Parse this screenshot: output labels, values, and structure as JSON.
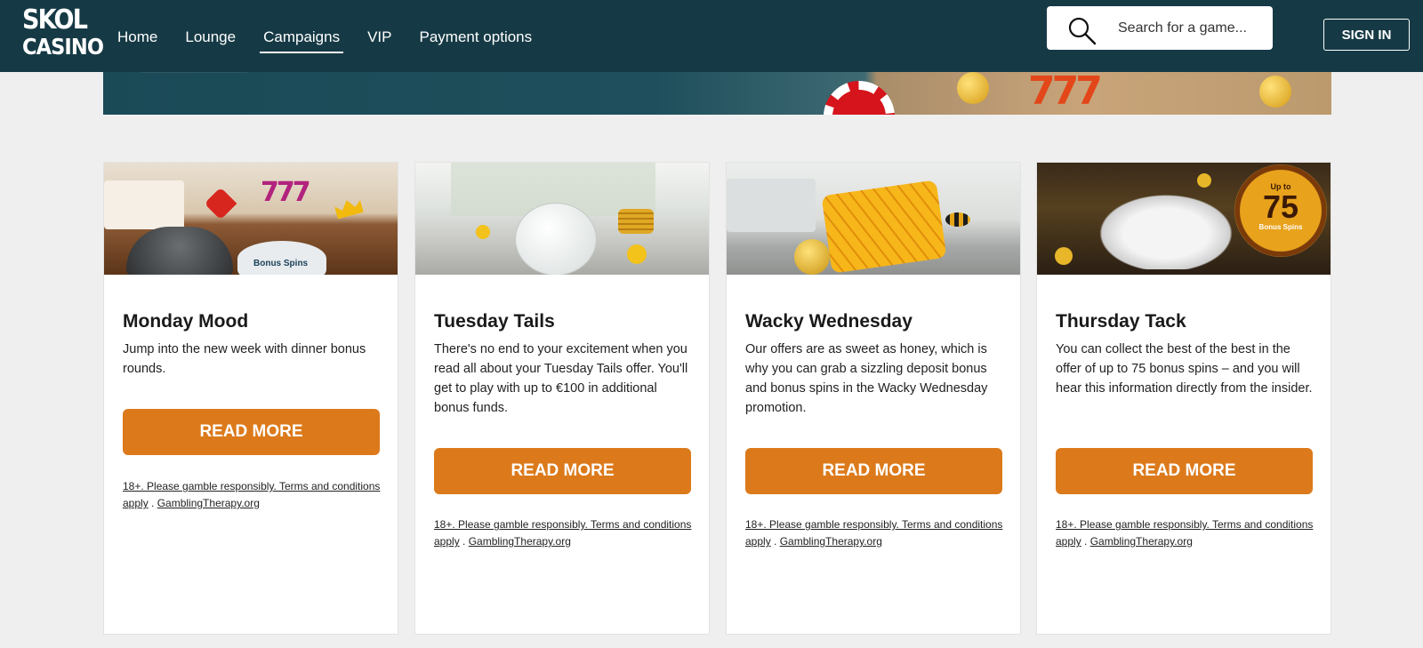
{
  "header": {
    "logo": {
      "line1": "SKOL",
      "line2": "CASINO"
    },
    "nav": [
      "Home",
      "Lounge",
      "Campaigns",
      "VIP",
      "Payment options"
    ],
    "active_nav": "Campaigns",
    "search": {
      "placeholder": "Search for a game...",
      "icon": "search-icon"
    },
    "signin_label": "SIGN IN"
  },
  "colors": {
    "header_bg": "#163a45",
    "button": "#dc7a1b",
    "page_bg": "#efefef"
  },
  "cards": [
    {
      "title": "Monday Mood",
      "description": "Jump into the new week with dinner bonus rounds.",
      "image_text": "Bonus Spins",
      "button": "READ MORE",
      "terms": "18+. Please gamble responsibly. Terms and conditions apply",
      "terms_sep": " . ",
      "terms_link": "GamblingTherapy.org"
    },
    {
      "title": "Tuesday Tails",
      "description": "There's no end to your excitement when you read all about your Tuesday Tails offer. You'll get to play with up to €100 in additional bonus funds.",
      "button": "READ MORE",
      "terms": "18+. Please gamble responsibly. Terms and conditions apply",
      "terms_sep": " . ",
      "terms_link": "GamblingTherapy.org"
    },
    {
      "title": "Wacky Wednesday",
      "description": "Our offers are as sweet as honey, which is why you can grab a sizzling deposit bonus and bonus spins in the Wacky Wednesday promotion.",
      "button": "READ MORE",
      "terms": "18+. Please gamble responsibly. Terms and conditions apply",
      "terms_sep": " . ",
      "terms_link": "GamblingTherapy.org"
    },
    {
      "title": "Thursday Tack",
      "description": "You can collect the best of the best in the offer of up to 75 bonus spins – and you will hear this information directly from the insider.",
      "image_badge": {
        "top": "Up to",
        "number": "75",
        "bottom": "Bonus Spins"
      },
      "button": "READ MORE",
      "terms": "18+. Please gamble responsibly. Terms and conditions apply",
      "terms_sep": " . ",
      "terms_link": "GamblingTherapy.org"
    }
  ]
}
